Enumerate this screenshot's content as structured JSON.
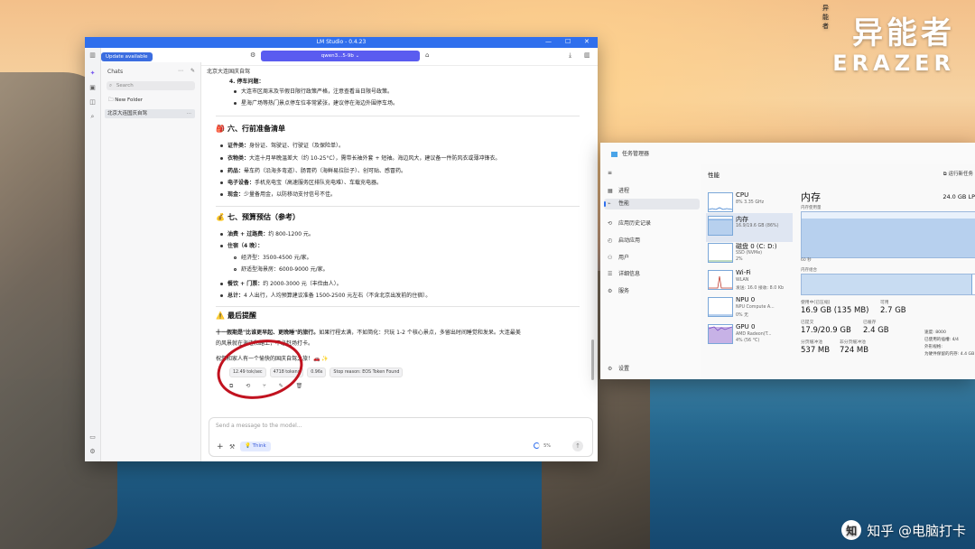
{
  "watermark": {
    "top": "异能者",
    "cn": "异能者",
    "en": "ERAZER"
  },
  "zhihu": {
    "logo": "知",
    "text": "知乎 @电脑打卡"
  },
  "lm": {
    "title": "LM Studio - 0.4.23",
    "update_label": "Update available",
    "chats_label": "Chats",
    "search_placeholder": "Search",
    "new_folder": "New Folder",
    "chat_item": "北京大连国庆自驾",
    "model_label": "qwen3...5-9b",
    "chat_title": "北京大连国庆自驾",
    "content": {
      "p4_title": "4. 停车问题：",
      "p4_b1": "大连市区周末及节假日限行政策严格，注意查看当日限号政策。",
      "p4_b2": "星海广场等热门景点停车位非常紧张，建议停在海边外围停车场。",
      "s6_emoji": "🎒",
      "s6_title": "六、行前准备清单",
      "s6_b1k": "证件类：",
      "s6_b1v": "身份证、驾驶证、行驶证（及保险单）。",
      "s6_b2k": "衣物类：",
      "s6_b2v": "大连十月早晚温差大（约 10-25°C），需带长袖外套 + 短袖。海边风大，建议备一件防风衣或薄冲锋衣。",
      "s6_b3k": "药品：",
      "s6_b3v": "晕车药（沿海多弯道）、肠胃药（海鲜易拉肚子）、创可贴、感冒药。",
      "s6_b4k": "电子设备：",
      "s6_b4v": "手机充电宝（高速服务区排队充电难）、车载充电器。",
      "s6_b5k": "现金：",
      "s6_b5v": "少量备用金，以防移动支付信号不佳。",
      "s7_emoji": "💰",
      "s7_title": "七、预算预估（参考）",
      "s7_b1k": "油费 + 过路费：",
      "s7_b1v": "约 800-1200 元。",
      "s7_b2k": "住宿（4 晚）：",
      "s7_b2a": "经济型：3500-4500 元/家。",
      "s7_b2b": "舒适型海景房：6000-9000 元/家。",
      "s7_b3k": "餐饮 + 门票：",
      "s7_b3v": "约 2000-3000 元（丰俭由人）。",
      "s7_b4k": "总计：",
      "s7_b4v": "4 人出行，人均预算建议准备 1500-2500 元左右（不含北京出发前的住宿）。",
      "last_emoji": "⚠️",
      "last_title": "最后提醒",
      "last_p1b": "十一假期是\"比谁更早起、更晚睡\"的旅行。",
      "last_p1": "如果行程太满，不如简化：只玩 1-2 个核心景点，多留出时间睡觉和发呆。大连最美",
      "last_p2": "的风景就在海边和路上，不必赶场打卡。",
      "last_p3": "祝您和家人有一个愉快的国庆自驾之旅！🚗 ✨"
    },
    "stats": {
      "speed": "12.49 tok/sec",
      "tokens": "4718 tokens",
      "ttft": "0.96s",
      "stop": "Stop reason: EOS Token Found"
    },
    "composer": {
      "placeholder": "Send a message to the model...",
      "think": "Think",
      "ctx": "5%"
    }
  },
  "tm": {
    "title": "任务管理器",
    "nav": [
      "进程",
      "性能",
      "应用历史记录",
      "启动应用",
      "用户",
      "详细信息",
      "服务"
    ],
    "settings": "设置",
    "header": "性能",
    "run_task": "运行新任务",
    "perf": [
      {
        "name": "CPU",
        "s1": "8% 3.35 GHz",
        "s2": ""
      },
      {
        "name": "内存",
        "s1": "16.9/19.6 GB (86%)",
        "s2": ""
      },
      {
        "name": "磁盘 0 (C: D:)",
        "s1": "SSD (NVMe)",
        "s2": "2%"
      },
      {
        "name": "Wi-Fi",
        "s1": "WLAN",
        "s2": "发送: 16.0  接收: 8.0 Kb"
      },
      {
        "name": "NPU 0",
        "s1": "NPU Compute A...",
        "s2": "0% 无"
      },
      {
        "name": "GPU 0",
        "s1": "AMD Radeon(T...",
        "s2": "4% (56 °C)"
      }
    ],
    "mem": {
      "title": "内存",
      "total": "24.0 GB LP",
      "graph_label": "内存使用量",
      "axis_left": "60 秒",
      "axis_right": "0",
      "comp_label": "内存组合",
      "usage_fraction": 0.86,
      "comp_used_fraction": 0.94,
      "stats": [
        {
          "l": "使用中(已压缩)",
          "v": "16.9 GB (135 MB)"
        },
        {
          "l": "可用",
          "v": "2.7 GB"
        },
        {
          "l": "已提交",
          "v": "17.9/20.9 GB"
        },
        {
          "l": "已缓存",
          "v": "2.4 GB"
        },
        {
          "l": "分页缓冲池",
          "v": "537 MB"
        },
        {
          "l": "非分页缓冲池",
          "v": "724 MB"
        }
      ],
      "side": [
        "速度:   8000",
        "已使用的插槽: 4/4",
        "外形规格:",
        "为硬件保留的内存: 4.4 GB"
      ]
    }
  }
}
